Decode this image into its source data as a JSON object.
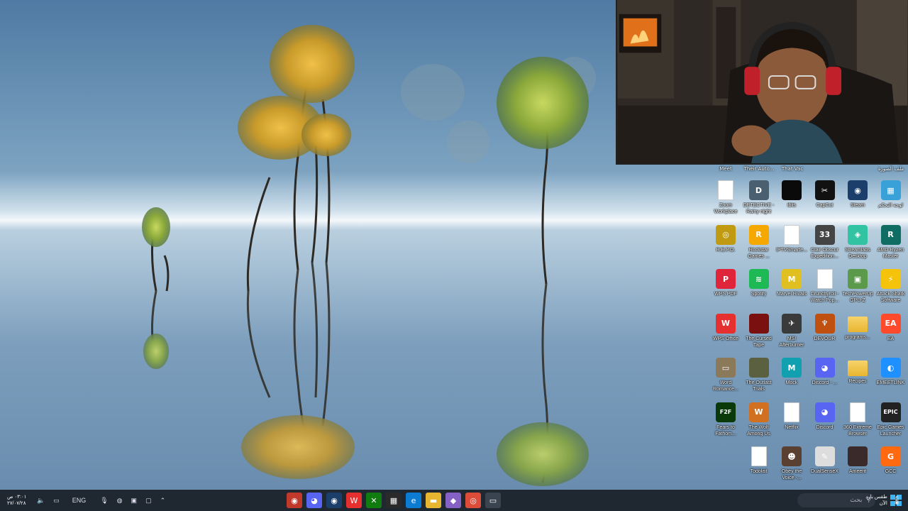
{
  "desktop": {
    "top_row_labels": [
      "Meet",
      "Their Auto...",
      "That Vac",
      "",
      "",
      "ملف الصورة"
    ],
    "icons": [
      {
        "label": "Zoom Workplace",
        "glyph": "",
        "style": "doc",
        "color": "#ffffff",
        "col": 0,
        "row": 0
      },
      {
        "label": "DETECTIVE - Rainy night",
        "glyph": "D",
        "color": "#4a6070",
        "col": 1,
        "row": 0
      },
      {
        "label": "iblis",
        "glyph": "",
        "color": "#0a0a0a",
        "col": 2,
        "row": 0
      },
      {
        "label": "CapCut",
        "glyph": "✂",
        "color": "#111111",
        "col": 3,
        "row": 0
      },
      {
        "label": "Steam",
        "glyph": "◉",
        "color": "#1b3e6b",
        "col": 4,
        "row": 0
      },
      {
        "label": "لوحة التحكم",
        "glyph": "▦",
        "color": "#3aa0d8",
        "col": 5,
        "row": 0
      },
      {
        "label": "R.E.P.O.",
        "glyph": "◎",
        "color": "#c09a10",
        "col": 0,
        "row": 1
      },
      {
        "label": "Rockstar Games ...",
        "glyph": "R",
        "color": "#f5a800",
        "col": 1,
        "row": 1
      },
      {
        "label": "IPTVSmarte...",
        "glyph": "",
        "style": "doc",
        "color": "#ffffff",
        "col": 2,
        "row": 1
      },
      {
        "label": "Clair Obscur Expedition...",
        "glyph": "33",
        "color": "#444444",
        "col": 3,
        "row": 1
      },
      {
        "label": "Streamlabs Desktop",
        "glyph": "◈",
        "color": "#31c3a2",
        "col": 4,
        "row": 1
      },
      {
        "label": "AMD Ryzen Master",
        "glyph": "R",
        "color": "#0f6d63",
        "col": 5,
        "row": 1
      },
      {
        "label": "WPS PDF",
        "glyph": "P",
        "color": "#e0243a",
        "col": 0,
        "row": 2
      },
      {
        "label": "Spotify",
        "glyph": "≋",
        "color": "#1db954",
        "col": 1,
        "row": 2
      },
      {
        "label": "Marvel Rivals",
        "glyph": "M",
        "color": "#e0c020",
        "col": 2,
        "row": 2
      },
      {
        "label": "Crunchyroll - Watch Pop...",
        "glyph": "",
        "style": "doc",
        "color": "#ffffff",
        "col": 3,
        "row": 2
      },
      {
        "label": "TechPowerUp GPU-Z",
        "glyph": "▣",
        "color": "#5a9a4a",
        "col": 4,
        "row": 2
      },
      {
        "label": "Attack Shark Software",
        "glyph": "⚡",
        "color": "#f4c30a",
        "col": 5,
        "row": 2
      },
      {
        "label": "WPS Office",
        "glyph": "W",
        "color": "#e63030",
        "col": 0,
        "row": 3
      },
      {
        "label": "The Cursed Tape",
        "glyph": "",
        "color": "#7a1010",
        "col": 1,
        "row": 3
      },
      {
        "label": "MSI Afterburner",
        "glyph": "✈",
        "color": "#3a3a3a",
        "col": 2,
        "row": 3
      },
      {
        "label": "DEVOUR",
        "glyph": "♆",
        "color": "#c05010",
        "col": 3,
        "row": 3
      },
      {
        "label": "programs...",
        "glyph": "",
        "style": "folder",
        "color": "#f0c040",
        "col": 4,
        "row": 3
      },
      {
        "label": "EA",
        "glyph": "EA",
        "color": "#ff4b2b",
        "col": 5,
        "row": 3
      },
      {
        "label": "Word Romance...",
        "glyph": "▭",
        "color": "#8a7a5a",
        "col": 0,
        "row": 4
      },
      {
        "label": "The Outlast Trials",
        "glyph": "",
        "color": "#5a6040",
        "col": 1,
        "row": 4
      },
      {
        "label": "Mock",
        "glyph": "M",
        "color": "#10a0b0",
        "col": 2,
        "row": 4
      },
      {
        "label": "Discord - ...",
        "glyph": "◕",
        "color": "#5865f2",
        "col": 3,
        "row": 4
      },
      {
        "label": "Recipes",
        "glyph": "",
        "style": "folder",
        "color": "#f0c040",
        "col": 4,
        "row": 4
      },
      {
        "label": "EMEETLINK",
        "glyph": "◐",
        "color": "#1e90ff",
        "col": 5,
        "row": 4
      },
      {
        "label": "Fears to Fathom...",
        "glyph": "F2F",
        "color": "#0a3a0a",
        "col": 0,
        "row": 5
      },
      {
        "label": "The Wolf Among Us",
        "glyph": "W",
        "color": "#d07020",
        "col": 1,
        "row": 5
      },
      {
        "label": "Netflix",
        "glyph": "",
        "style": "doc",
        "color": "#ffffff",
        "col": 2,
        "row": 5
      },
      {
        "label": "Discord",
        "glyph": "◕",
        "color": "#5865f2",
        "col": 3,
        "row": 5
      },
      {
        "label": "360 Extreme Browser",
        "glyph": "",
        "style": "doc",
        "color": "#ffffff",
        "col": 4,
        "row": 5
      },
      {
        "label": "Epic Games Launcher",
        "glyph": "EPIC",
        "color": "#222222",
        "col": 5,
        "row": 5
      },
      {
        "label": "Todolist",
        "glyph": "",
        "style": "doc",
        "color": "#ffffff",
        "col": 1,
        "row": 6
      },
      {
        "label": "Obey the Voice -...",
        "glyph": "☻",
        "color": "#5a4030",
        "col": 2,
        "row": 6
      },
      {
        "label": "DualSenseX",
        "glyph": "✎",
        "color": "#dddddd",
        "col": 3,
        "row": 6
      },
      {
        "label": "Ameerit",
        "glyph": "",
        "color": "#3a2a2a",
        "col": 4,
        "row": 6
      },
      {
        "label": "GCC",
        "glyph": "G",
        "color": "#ff6a10",
        "col": 5,
        "row": 6
      }
    ]
  },
  "taskbar": {
    "clock_time": "٠٣:٠١ ص",
    "clock_date": "٢٧/٠٧/٢٨",
    "language": "ENG",
    "search_placeholder": "بحث",
    "weather_line1": "طقس بارد",
    "weather_line2": "الآن",
    "pinned": [
      {
        "name": "chrome-canary-icon",
        "glyph": "◉",
        "color": "#c0392b"
      },
      {
        "name": "discord-taskbar-icon",
        "glyph": "◕",
        "color": "#5865f2"
      },
      {
        "name": "steam-taskbar-icon",
        "glyph": "◉",
        "color": "#1b3e6b"
      },
      {
        "name": "wps-taskbar-icon",
        "glyph": "W",
        "color": "#e63030"
      },
      {
        "name": "xbox-icon",
        "glyph": "✕",
        "color": "#107c10"
      },
      {
        "name": "calculator-icon",
        "glyph": "▦",
        "color": "#2a2a2a"
      },
      {
        "name": "edge-icon",
        "glyph": "e",
        "color": "#0c7bd2"
      },
      {
        "name": "file-explorer-icon",
        "glyph": "▬",
        "color": "#e8b530"
      },
      {
        "name": "visual-studio-icon",
        "glyph": "◆",
        "color": "#8661c5"
      },
      {
        "name": "chrome-icon",
        "glyph": "◎",
        "color": "#dd4b39"
      },
      {
        "name": "notepad-icon",
        "glyph": "▭",
        "color": "#3a4350"
      }
    ]
  }
}
